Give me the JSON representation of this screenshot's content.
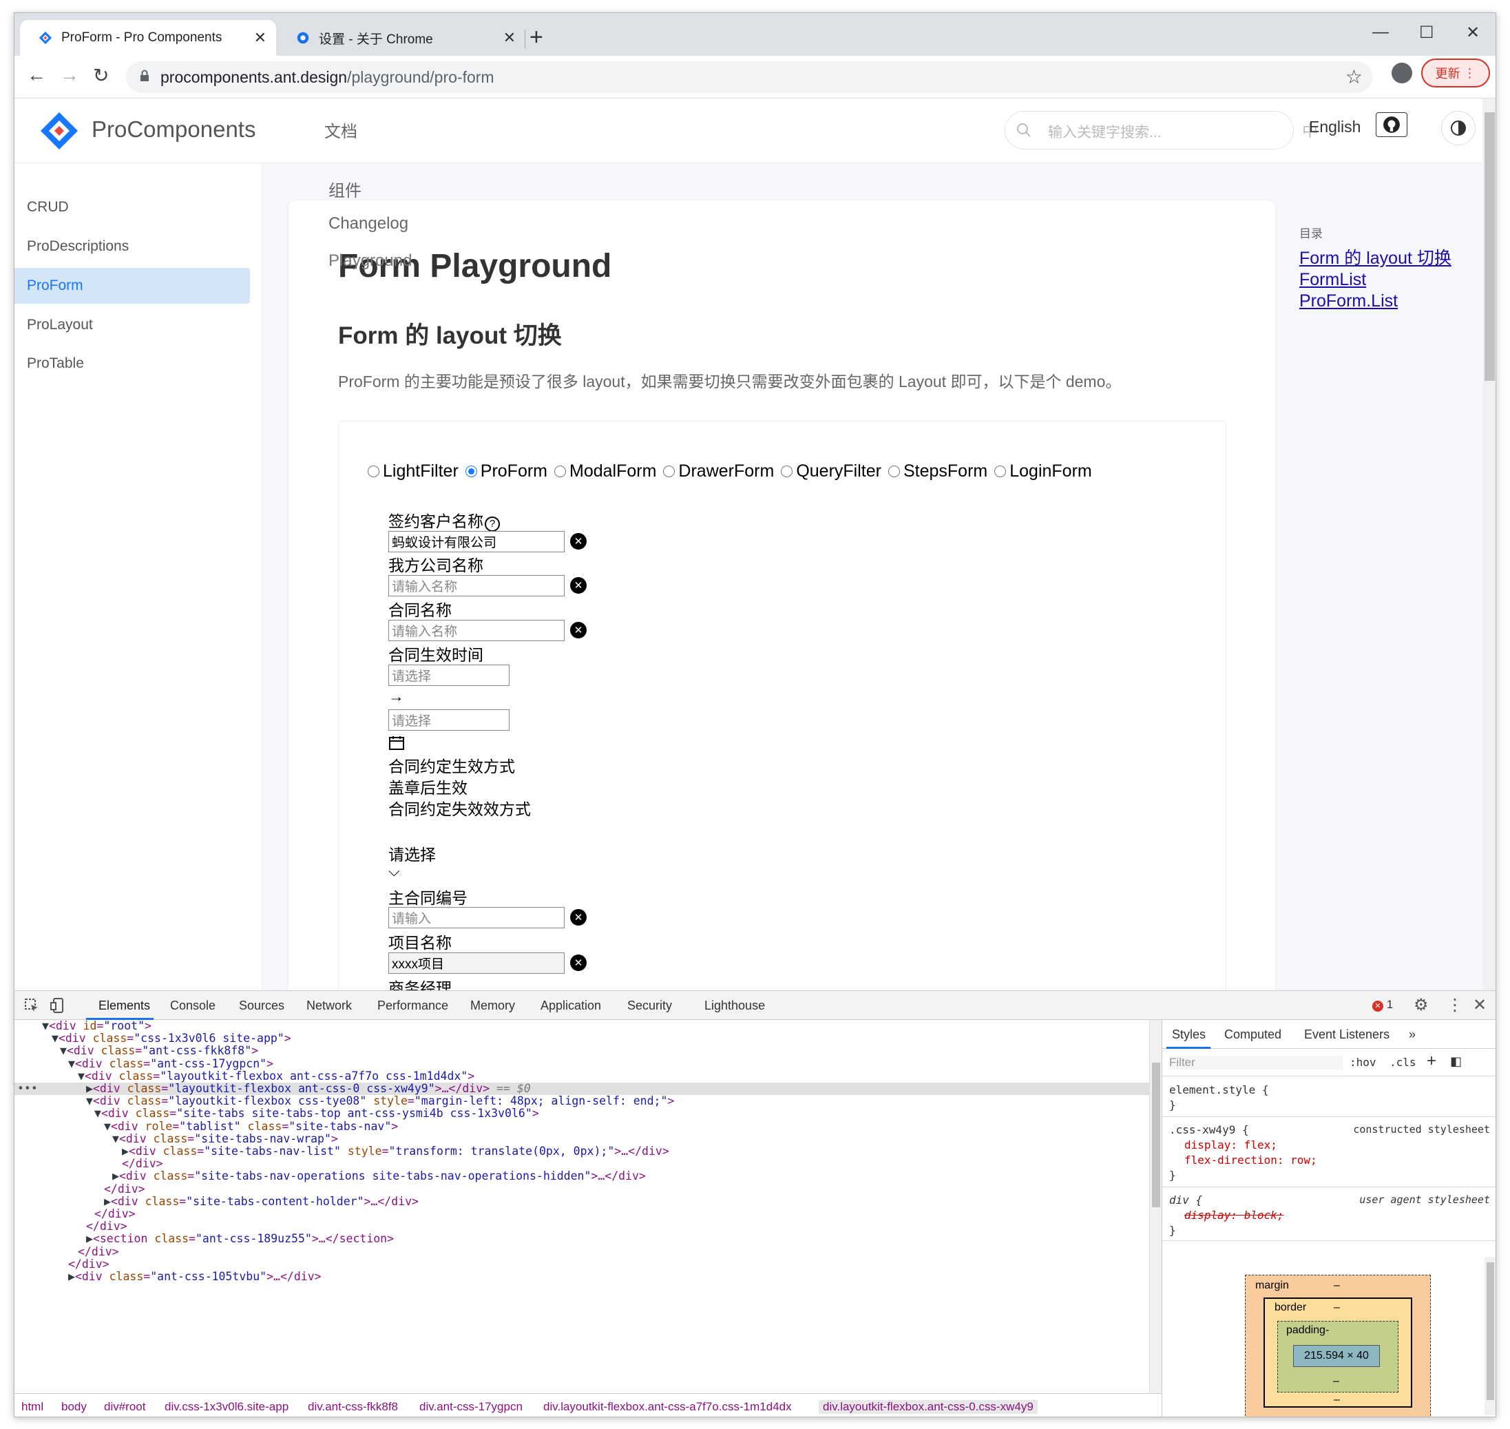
{
  "browser": {
    "tabs": [
      {
        "title": "ProForm - Pro Components",
        "active": true,
        "favicon": "procomponents-diamond-icon"
      },
      {
        "title": "设置 - 关于 Chrome",
        "active": false,
        "favicon": "settings-gear-icon"
      }
    ],
    "url_host": "procomponents.ant.design",
    "url_path": "/playground/pro-form",
    "update_label": "更新"
  },
  "site": {
    "logo_text": "ProComponents",
    "nav": [
      "文档",
      "组件",
      "Changelog",
      "Playground"
    ],
    "search_placeholder": "输入关键字搜索...",
    "lang_label": "English",
    "lang_overlap": "中",
    "sidebar": [
      "CRUD",
      "ProDescriptions",
      "ProForm",
      "ProLayout",
      "ProTable"
    ],
    "active_sidebar": "ProForm",
    "title": "Form Playground",
    "section_title": "Form 的 layout 切换",
    "description": "ProForm 的主要功能是预设了很多 layout，如果需要切换只需要改变外面包裹的 Layout 即可，以下是个 demo。",
    "toc_title": "目录",
    "toc": [
      "Form 的 layout 切换",
      "FormList",
      "ProForm.List"
    ]
  },
  "form": {
    "layouts": [
      "LightFilter",
      "ProForm",
      "ModalForm",
      "DrawerForm",
      "QueryFilter",
      "StepsForm",
      "LoginForm"
    ],
    "selected_layout": "ProForm",
    "fields": {
      "customer_label": "签约客户名称",
      "customer_value": "蚂蚁设计有限公司",
      "company_label": "我方公司名称",
      "company_placeholder": "请输入名称",
      "contract_label": "合同名称",
      "contract_placeholder": "请输入名称",
      "date_label": "合同生效时间",
      "date_start_placeholder": "请选择",
      "date_arrow": "→",
      "date_end_placeholder": "请选择",
      "effective_label": "合同约定生效方式",
      "effective_value": "盖章后生效",
      "expire_label": "合同约定失效效方式",
      "select_placeholder": "请选择",
      "main_contract_label": "主合同编号",
      "main_contract_placeholder": "请输入",
      "project_label": "项目名称",
      "project_value": "xxxx项目",
      "manager_label": "商务经理"
    }
  },
  "devtools": {
    "tabs": [
      "Elements",
      "Console",
      "Sources",
      "Network",
      "Performance",
      "Memory",
      "Application",
      "Security",
      "Lighthouse"
    ],
    "error_count": "1",
    "styles_tabs": [
      "Styles",
      "Computed",
      "Event Listeners"
    ],
    "filter_placeholder": "Filter",
    "hov": ":hov",
    "cls": ".cls",
    "element_style": "element.style {",
    "rule1_selector": ".css-xw4y9 {",
    "rule1_source": "constructed stylesheet",
    "rule1_decl1": "display: flex;",
    "rule1_decl2": "flex-direction: row;",
    "rule2_selector": "div {",
    "rule2_source": "user agent stylesheet",
    "rule2_decl": "display: block;",
    "box_margin": "margin",
    "box_border": "border",
    "box_padding": "padding-",
    "box_size": "215.594 × 40",
    "box_dash": "–",
    "selected_suffix": " == $0",
    "crumbs": [
      "html",
      "body",
      "div#root",
      "div.css-1x3v0l6.site-app",
      "div.ant-css-fkk8f8",
      "div.ant-css-17ygpcn",
      "div.layoutkit-flexbox.ant-css-a7f7o.css-1m1d4dx",
      "div.layoutkit-flexbox.ant-css-0.css-xw4y9"
    ],
    "dom": [
      "▼<div id=\"root\">",
      "▼<div class=\"css-1x3v0l6 site-app\">",
      "▼<div class=\"ant-css-fkk8f8\">",
      "▼<div class=\"ant-css-17ygpcn\">",
      "▼<div class=\"layoutkit-flexbox ant-css-a7f7o css-1m1d4dx\">",
      "▶<div class=\"layoutkit-flexbox ant-css-0 css-xw4y9\">…</div>",
      "▼<div class=\"layoutkit-flexbox css-tye08\" style=\"margin-left: 48px; align-self: end;\">",
      "▼<div class=\"site-tabs site-tabs-top ant-css-ysmi4b css-1x3v0l6\">",
      "▼<div role=\"tablist\" class=\"site-tabs-nav\">",
      "▼<div class=\"site-tabs-nav-wrap\">",
      "▶<div class=\"site-tabs-nav-list\" style=\"transform: translate(0px, 0px);\">…</div>",
      "</div>",
      "▶<div class=\"site-tabs-nav-operations site-tabs-nav-operations-hidden\">…</div>",
      "</div>",
      "▶<div class=\"site-tabs-content-holder\">…</div>",
      "</div>",
      "</div>",
      "▶<section class=\"ant-css-189uz55\">…</section>",
      "</div>",
      "</div>",
      "▶<div class=\"ant-css-105tvbu\">…</div>"
    ]
  },
  "colors": {
    "accent": "#1677ff",
    "active_bg": "#d3e5f6",
    "update_red": "#d93025",
    "tag": "#881280",
    "attr": "#994500",
    "value": "#1a1aa6"
  }
}
